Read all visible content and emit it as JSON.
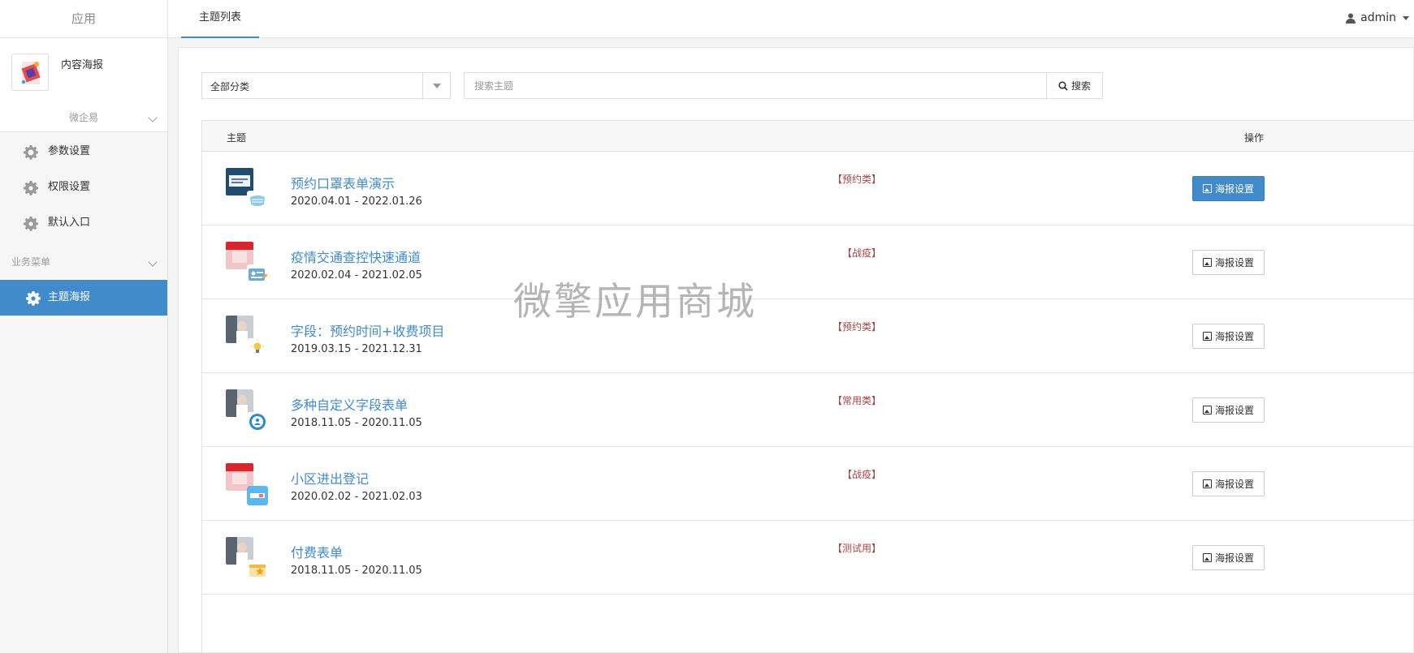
{
  "sidebar": {
    "header": "应用",
    "app_name": "内容海报",
    "group1": "微企易",
    "items": [
      {
        "label": "参数设置"
      },
      {
        "label": "权限设置"
      },
      {
        "label": "默认入口"
      }
    ],
    "group2": "业务菜单",
    "active_item": "主题海报"
  },
  "topbar": {
    "tab": "主题列表",
    "user": "admin"
  },
  "filter": {
    "category": "全部分类"
  },
  "search": {
    "placeholder": "搜索主题",
    "button": "搜索"
  },
  "table": {
    "col_topic": "主题",
    "col_action": "操作",
    "action_label": "海报设置",
    "rows": [
      {
        "title": "预约口罩表单演示",
        "dates": "2020.04.01 - 2022.01.26",
        "tag": "【预约类】"
      },
      {
        "title": "疫情交通查控快速通道",
        "dates": "2020.02.04 - 2021.02.05",
        "tag": "【战疫】"
      },
      {
        "title": "字段：预约时间+收费项目",
        "dates": "2019.03.15 - 2021.12.31",
        "tag": "【预约类】"
      },
      {
        "title": "多种自定义字段表单",
        "dates": "2018.11.05 - 2020.11.05",
        "tag": "【常用类】"
      },
      {
        "title": "小区进出登记",
        "dates": "2020.02.02 - 2021.02.03",
        "tag": "【战疫】"
      },
      {
        "title": "付费表单",
        "dates": "2018.11.05 - 2020.11.05",
        "tag": "【测试用】"
      }
    ]
  },
  "watermark": "微擎应用商城",
  "colors": {
    "accent": "#428bca",
    "tag": "#a94442"
  }
}
